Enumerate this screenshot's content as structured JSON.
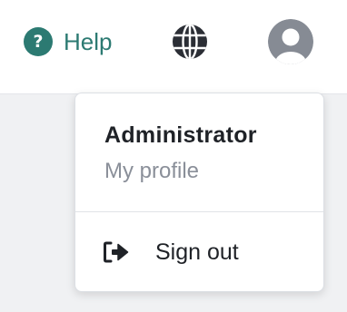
{
  "header": {
    "help": {
      "label": "Help",
      "icon": "help-circle-icon",
      "icon_glyph": "?",
      "color": "#2c7a72"
    },
    "language": {
      "icon": "globe-icon",
      "color": "#2b2e35"
    },
    "account": {
      "icon": "user-avatar-icon",
      "color": "#868b94"
    }
  },
  "user_menu": {
    "name": "Administrator",
    "profile_link": "My profile",
    "sign_out": {
      "label": "Sign out",
      "icon": "sign-out-icon"
    }
  },
  "colors": {
    "text_primary": "#1f2227",
    "text_muted": "#8a8f99",
    "accent": "#2c7a72",
    "background": "#f0f1f3"
  }
}
